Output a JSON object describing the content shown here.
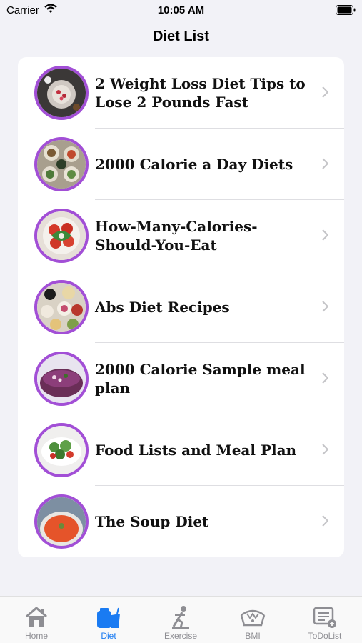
{
  "status_bar": {
    "carrier": "Carrier",
    "time": "10:05 AM"
  },
  "nav": {
    "title": "Diet List"
  },
  "diet_list": [
    {
      "title": "2 Weight Loss Diet Tips to Lose 2 Pounds Fast"
    },
    {
      "title": "2000 Calorie a Day Diets"
    },
    {
      "title": "How-Many-Calories-Should-You-Eat"
    },
    {
      "title": "Abs Diet Recipes"
    },
    {
      "title": "2000 Calorie Sample meal plan"
    },
    {
      "title": "Food Lists and Meal Plan"
    },
    {
      "title": "The Soup Diet"
    }
  ],
  "tabs": [
    {
      "label": "Home",
      "icon": "home-icon"
    },
    {
      "label": "Diet",
      "icon": "diet-icon",
      "active": true
    },
    {
      "label": "Exercise",
      "icon": "exercise-icon"
    },
    {
      "label": "BMI",
      "icon": "bmi-icon"
    },
    {
      "label": "ToDoList",
      "icon": "todolist-icon"
    }
  ],
  "colors": {
    "accent": "#1a7bf2",
    "thumb_border": "#a24fd6",
    "background": "#f2f2f7"
  }
}
